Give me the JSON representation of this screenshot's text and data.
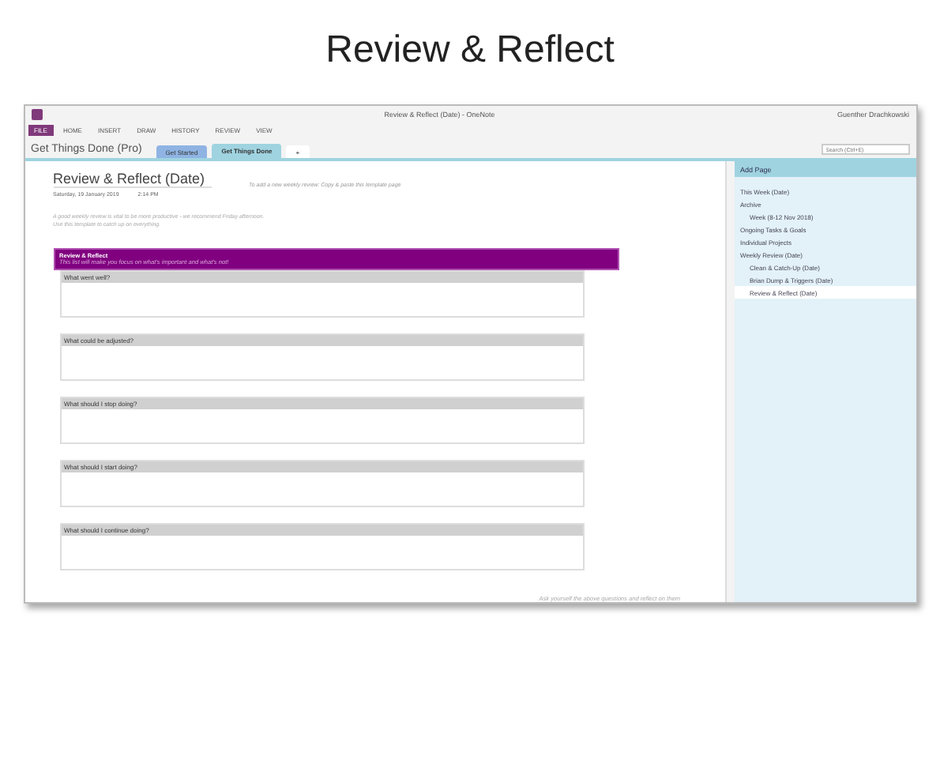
{
  "slide_title": "Review & Reflect",
  "window": {
    "title": "Review & Reflect (Date) - OneNote",
    "account": "Guenther Drachkowski"
  },
  "ribbon_tabs": [
    {
      "label": "FILE",
      "selected": true
    },
    {
      "label": "HOME",
      "selected": false
    },
    {
      "label": "INSERT",
      "selected": false
    },
    {
      "label": "DRAW",
      "selected": false
    },
    {
      "label": "HISTORY",
      "selected": false
    },
    {
      "label": "REVIEW",
      "selected": false
    },
    {
      "label": "VIEW",
      "selected": false
    }
  ],
  "notebook": "Get Things Done (Pro)",
  "section_tabs": [
    {
      "label": "Get Started",
      "selected": false,
      "color": "#8fb4e3"
    },
    {
      "label": "Get Things Done",
      "selected": true,
      "color": "#9fd3e0"
    },
    {
      "label": "+",
      "selected": false,
      "color": "#ffffff"
    }
  ],
  "search": {
    "placeholder": "Search (Ctrl+E)"
  },
  "page": {
    "title": "Review & Reflect (Date)",
    "date": "Saturday, 19 January 2019",
    "time": "2:14 PM",
    "hint": "To add a new weekly review: Copy & paste this template page",
    "intro": [
      "A good weekly review is vital to be more productive - we recommend Friday afternoon.",
      "Use this template to catch up on everything."
    ],
    "banner": {
      "title": "Review & Reflect",
      "subtitle": "This list will make you focus on what's important and what's not!"
    },
    "questions": [
      "What went well?",
      "What could be adjusted?",
      "What should I stop doing?",
      "What should I start doing?",
      "What should I continue doing?"
    ],
    "footer": "Ask yourself the above questions and reflect on them"
  },
  "add_page": "Add Page",
  "pages": [
    {
      "label": "This Week (Date)",
      "selected": false
    },
    {
      "label": "Archive",
      "selected": false,
      "children": [
        {
          "label": "Week (8-12 Nov 2018)",
          "selected": false
        }
      ]
    },
    {
      "label": "Ongoing Tasks & Goals",
      "selected": false
    },
    {
      "label": "Individual Projects",
      "selected": false
    },
    {
      "label": "Weekly Review (Date)",
      "selected": false,
      "children": [
        {
          "label": "Clean & Catch-Up (Date)",
          "selected": false
        },
        {
          "label": "Brian Dump & Triggers (Date)",
          "selected": false
        },
        {
          "label": "Review & Reflect (Date)",
          "selected": true
        }
      ]
    }
  ]
}
